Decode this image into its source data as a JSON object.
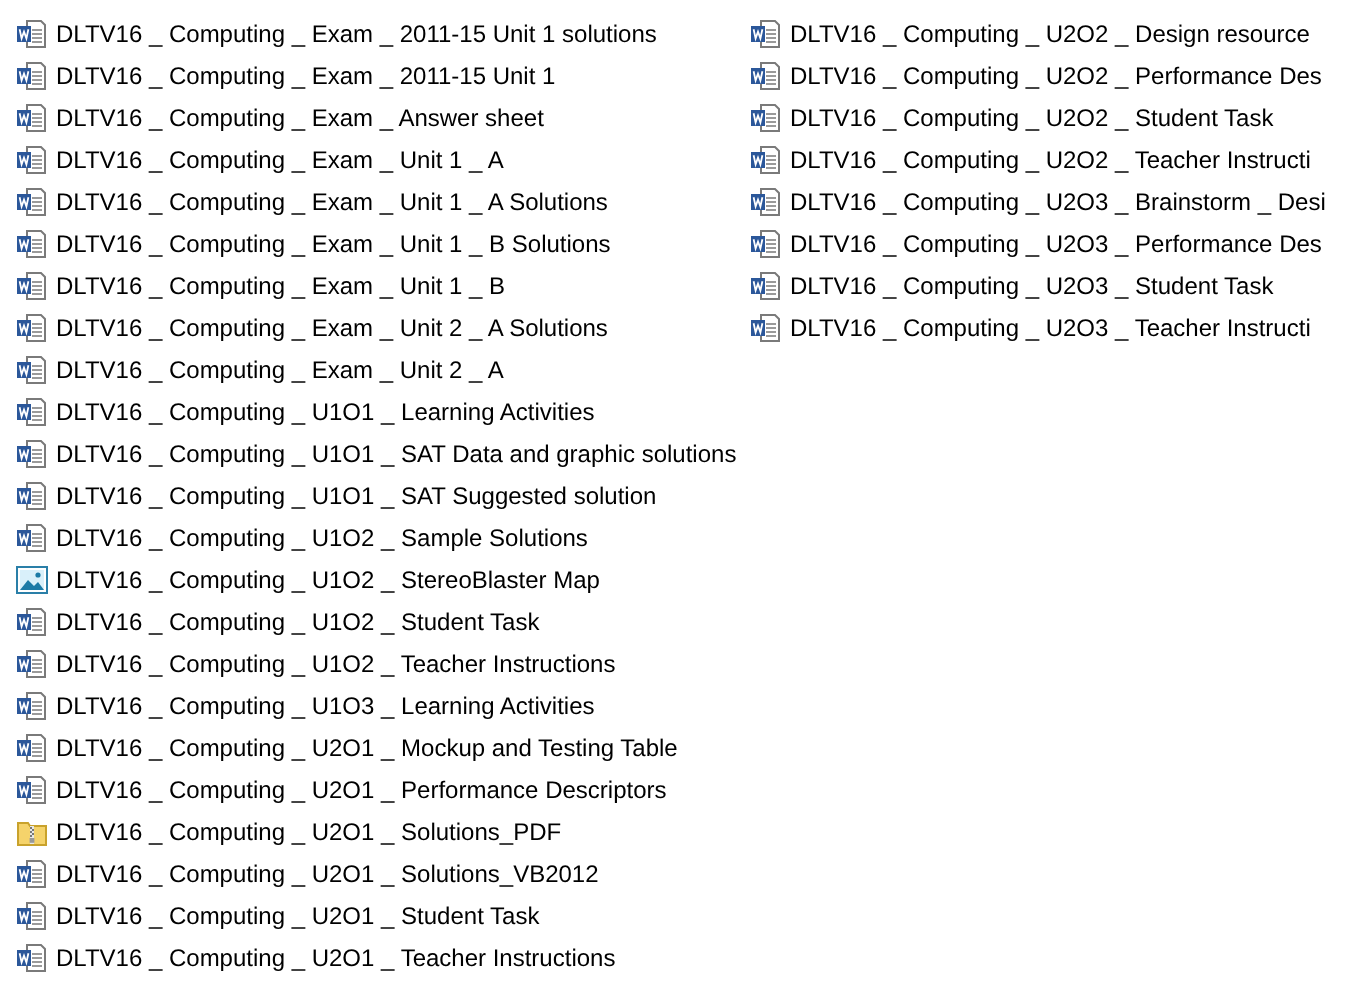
{
  "files": [
    {
      "name": "DLTV16 _ Computing _ Exam _ 2011-15 Unit 1 solutions",
      "kind": "document"
    },
    {
      "name": "DLTV16 _ Computing _ Exam _ 2011-15 Unit 1",
      "kind": "document"
    },
    {
      "name": "DLTV16 _ Computing _ Exam _ Answer sheet",
      "kind": "document"
    },
    {
      "name": "DLTV16 _ Computing _ Exam _ Unit 1 _ A",
      "kind": "document"
    },
    {
      "name": "DLTV16 _ Computing _ Exam _ Unit 1 _ A Solutions",
      "kind": "document"
    },
    {
      "name": "DLTV16 _ Computing _ Exam _ Unit 1 _ B Solutions",
      "kind": "document"
    },
    {
      "name": "DLTV16 _ Computing _ Exam _ Unit 1 _ B",
      "kind": "document"
    },
    {
      "name": "DLTV16 _ Computing _ Exam _ Unit 2 _ A Solutions",
      "kind": "document"
    },
    {
      "name": "DLTV16 _ Computing _ Exam _ Unit 2 _ A",
      "kind": "document"
    },
    {
      "name": "DLTV16 _ Computing _ U1O1 _ Learning Activities",
      "kind": "document"
    },
    {
      "name": "DLTV16 _ Computing _ U1O1 _ SAT Data and graphic solutions",
      "kind": "document"
    },
    {
      "name": "DLTV16 _ Computing _ U1O1 _ SAT Suggested solution",
      "kind": "document"
    },
    {
      "name": "DLTV16 _ Computing _ U1O2 _ Sample Solutions",
      "kind": "document"
    },
    {
      "name": "DLTV16 _ Computing _ U1O2 _ StereoBlaster Map",
      "kind": "image"
    },
    {
      "name": "DLTV16 _ Computing _ U1O2 _ Student Task",
      "kind": "document"
    },
    {
      "name": "DLTV16 _ Computing _ U1O2 _ Teacher Instructions",
      "kind": "document"
    },
    {
      "name": "DLTV16 _ Computing _ U1O3 _ Learning Activities",
      "kind": "document"
    },
    {
      "name": "DLTV16 _ Computing _ U2O1 _ Mockup and Testing Table",
      "kind": "document"
    },
    {
      "name": "DLTV16 _ Computing _ U2O1 _ Performance Descriptors",
      "kind": "document"
    },
    {
      "name": "DLTV16 _ Computing _ U2O1 _ Solutions_PDF",
      "kind": "zip"
    },
    {
      "name": "DLTV16 _ Computing _ U2O1 _ Solutions_VB2012",
      "kind": "document"
    },
    {
      "name": "DLTV16 _ Computing _ U2O1 _ Student Task",
      "kind": "document"
    },
    {
      "name": "DLTV16 _ Computing _ U2O1 _ Teacher Instructions",
      "kind": "document"
    },
    {
      "name": "DLTV16 _ Computing _ U2O2 _ Design resource",
      "kind": "document"
    },
    {
      "name": "DLTV16 _ Computing _ U2O2 _ Performance Des",
      "kind": "document"
    },
    {
      "name": "DLTV16 _ Computing _ U2O2 _ Student Task",
      "kind": "document"
    },
    {
      "name": "DLTV16 _ Computing _ U2O2 _ Teacher Instructi",
      "kind": "document"
    },
    {
      "name": "DLTV16 _ Computing _ U2O3 _ Brainstorm _ Desi",
      "kind": "document"
    },
    {
      "name": "DLTV16 _ Computing _ U2O3 _ Performance Des",
      "kind": "document"
    },
    {
      "name": "DLTV16 _ Computing _ U2O3 _ Student Task",
      "kind": "document"
    },
    {
      "name": "DLTV16 _ Computing _ U2O3 _ Teacher Instructi",
      "kind": "document"
    }
  ]
}
